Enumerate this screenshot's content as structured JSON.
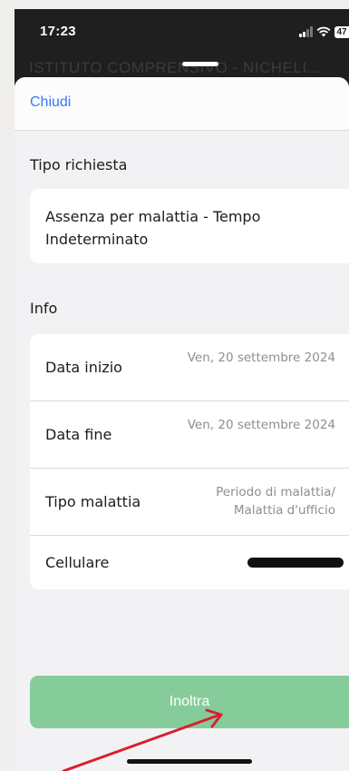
{
  "status_bar": {
    "time": "17:23",
    "battery": "47"
  },
  "background": {
    "title": "ISTITUTO COMPRENSIVO - NICHELI..."
  },
  "sheet": {
    "close_label": "Chiudi",
    "request_section": {
      "title": "Tipo richiesta",
      "value": "Assenza per malattia - Tempo Indeterminato"
    },
    "info_section": {
      "title": "Info",
      "rows": [
        {
          "label": "Data inizio",
          "value": "Ven, 20 settembre 2024"
        },
        {
          "label": "Data fine",
          "value": "Ven, 20 settembre 2024"
        },
        {
          "label": "Tipo malattia",
          "value": "Periodo di malattia/ Malattia d'ufficio"
        },
        {
          "label": "Cellulare",
          "value": ""
        }
      ]
    },
    "submit_label": "Inoltra"
  },
  "colors": {
    "accent_link": "#3478f6",
    "submit_button": "#86cc9a",
    "annotation_arrow": "#d8202f"
  }
}
